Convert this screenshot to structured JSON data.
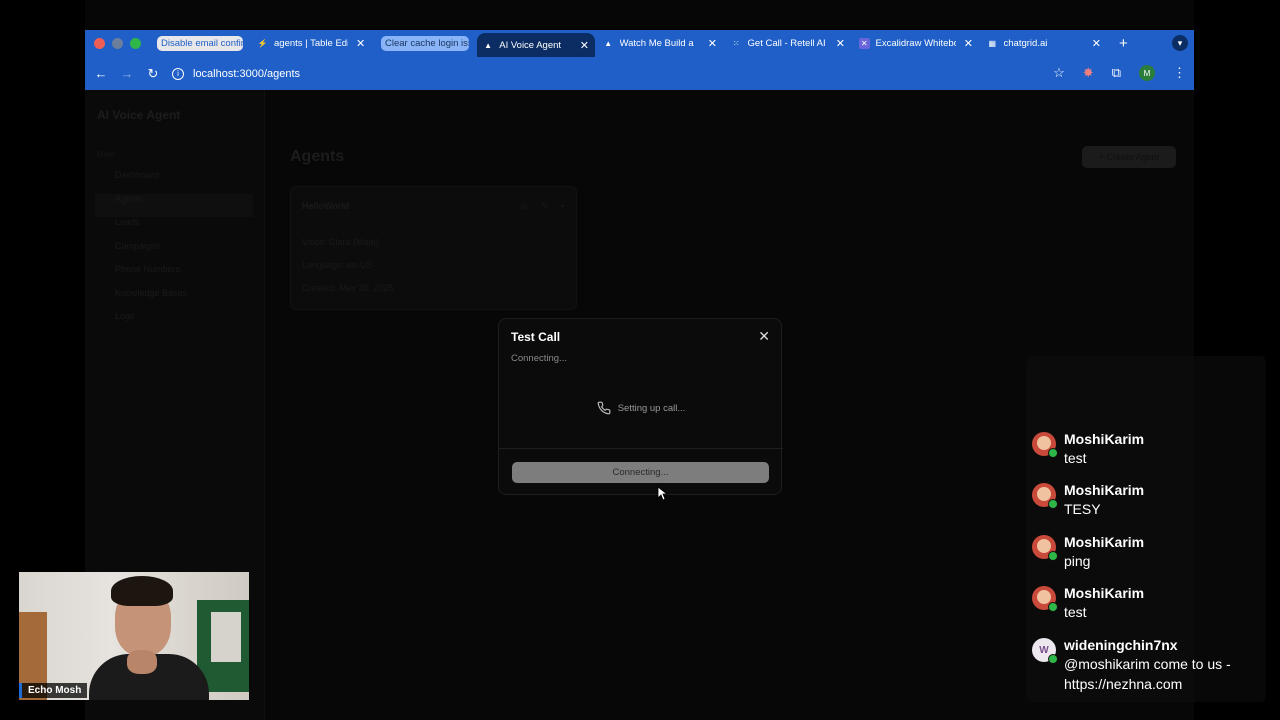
{
  "browser": {
    "tabs": [
      {
        "title": "Disable email confirm",
        "style": "pill-light",
        "favicon": ""
      },
      {
        "title": "agents | Table Editor",
        "style": "normal",
        "favicon": "supabase-icon"
      },
      {
        "title": "Clear cache login issue",
        "style": "pill-blue",
        "favicon": ""
      },
      {
        "title": "AI Voice Agent",
        "style": "active",
        "favicon": "vercel-icon"
      },
      {
        "title": "Watch Me Build a",
        "style": "normal",
        "favicon": "vercel-icon"
      },
      {
        "title": "Get Call - Retell AI",
        "style": "normal",
        "favicon": "retell-icon"
      },
      {
        "title": "Excalidraw Whiteboard",
        "style": "normal",
        "favicon": "excalidraw-icon"
      },
      {
        "title": "chatgrid.ai",
        "style": "normal",
        "favicon": "chatgrid-icon"
      }
    ],
    "url": "localhost:3000/agents",
    "profile_initial": "M"
  },
  "app": {
    "brand": "AI Voice Agent",
    "menu_heading": "Main",
    "menu": [
      "Dashboard",
      "Agents",
      "Leads",
      "Campaigns",
      "Phone Numbers",
      "Knowledge Bases",
      "Logs"
    ],
    "page_title": "Agents",
    "create_button": "+ Create Agent",
    "agent_card": {
      "name": "HelloWorld",
      "voice": "Voice: Clara (Male)",
      "language": "Language: en-US",
      "created": "Created: May 30, 2025"
    }
  },
  "modal": {
    "title": "Test Call",
    "subtitle": "Connecting...",
    "status": "Setting up call...",
    "button": "Connecting..."
  },
  "chat": {
    "messages": [
      {
        "user": "MoshiKarim",
        "text": "test",
        "avatar": "red"
      },
      {
        "user": "MoshiKarim",
        "text": "TESY",
        "avatar": "red"
      },
      {
        "user": "MoshiKarim",
        "text": "ping",
        "avatar": "red"
      },
      {
        "user": "MoshiKarim",
        "text": "test",
        "avatar": "red"
      },
      {
        "user": "wideningchin7nx",
        "text": "@moshikarim come to us - https://nezhna.com",
        "avatar": "white",
        "initial": "W"
      }
    ]
  },
  "webcam": {
    "name": "Echo Mosh"
  }
}
